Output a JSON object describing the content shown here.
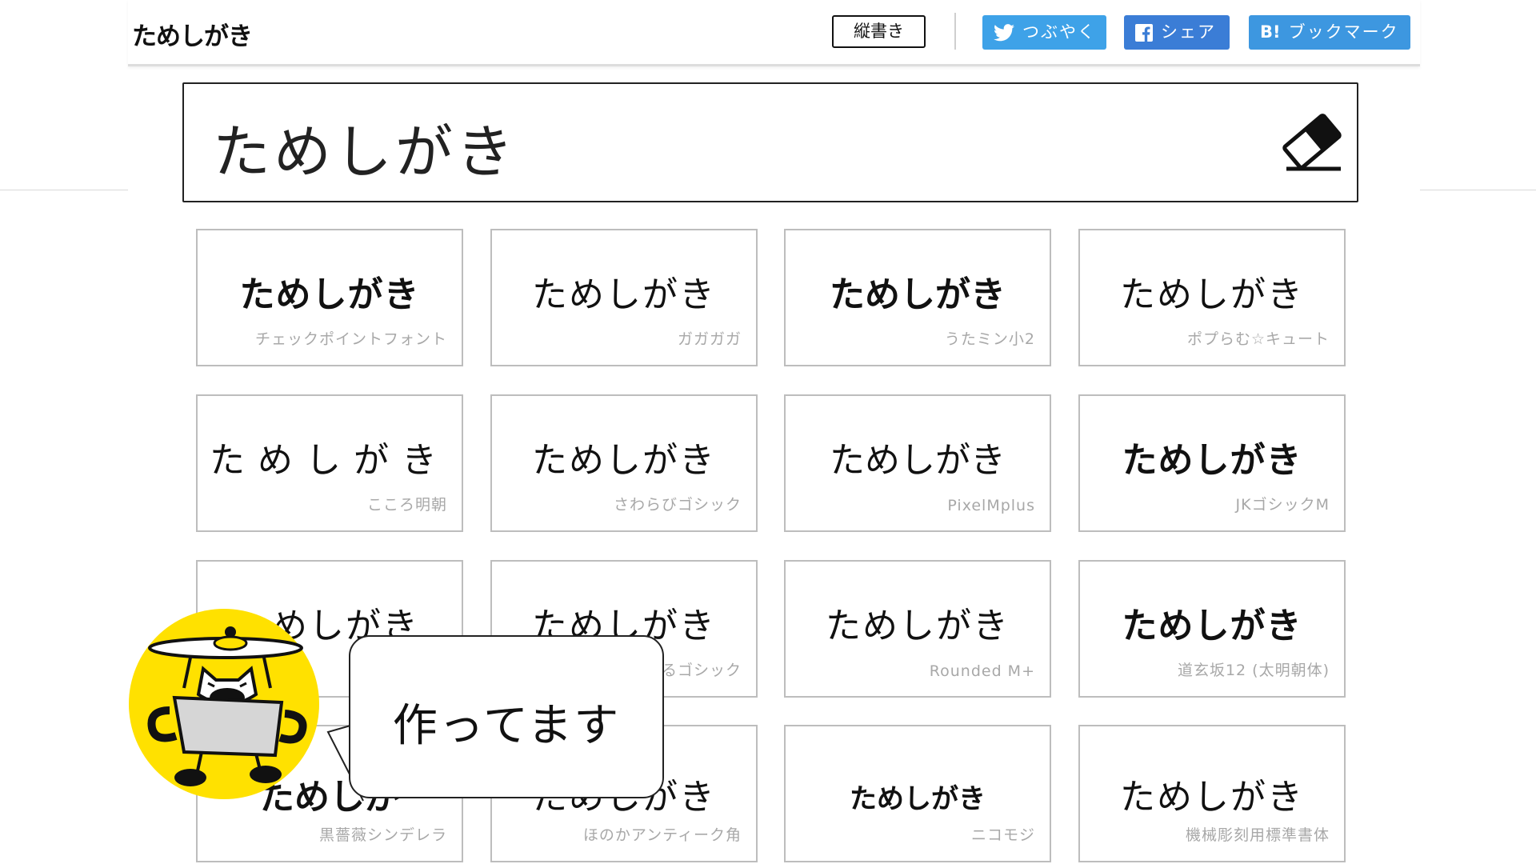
{
  "header": {
    "logo": "ためしがき",
    "vertical_button": "縦書き",
    "share": {
      "tweet": "つぶやく",
      "facebook": "シェア",
      "hatena_mark": "B!",
      "hatena": "ブックマーク"
    }
  },
  "input": {
    "value": "ためしがき",
    "clear_icon": "eraser-icon"
  },
  "fonts": [
    {
      "sample": "ためしがき",
      "name": "チェックポイントフォント"
    },
    {
      "sample": "ためしがき",
      "name": "ガガガガ"
    },
    {
      "sample": "ためしがき",
      "name": "うたミン小2"
    },
    {
      "sample": "ためしがき",
      "name": "ポプらむ☆キュート"
    },
    {
      "sample": "ためしがき",
      "name": "こころ明朝"
    },
    {
      "sample": "ためしがき",
      "name": "さわらびゴシック"
    },
    {
      "sample": "ためしがき",
      "name": "PixelMplus"
    },
    {
      "sample": "ためしがき",
      "name": "JKゴシックM"
    },
    {
      "sample": "めしがき",
      "name": ""
    },
    {
      "sample": "ためしがき",
      "name": "るゴシック"
    },
    {
      "sample": "ためしがき",
      "name": "Rounded M+"
    },
    {
      "sample": "ためしがき",
      "name": "道玄坂12 (太明朝体)"
    },
    {
      "sample": "ためしが",
      "name": "黒薔薇シンデレラ"
    },
    {
      "sample": "ためしがき",
      "name": "ほのかアンティーク角"
    },
    {
      "sample": "ためしがき",
      "name": "ニコモジ"
    },
    {
      "sample": "ためしがき",
      "name": "機械彫刻用標準書体"
    }
  ],
  "overlay": {
    "bubble_text": "作ってます",
    "mascot_icon": "cat-mascot-icon"
  },
  "colors": {
    "twitter": "#3ea2e8",
    "facebook": "#3b7dd6",
    "hatena": "#3d97e0",
    "mascot_bg": "#ffe100"
  }
}
